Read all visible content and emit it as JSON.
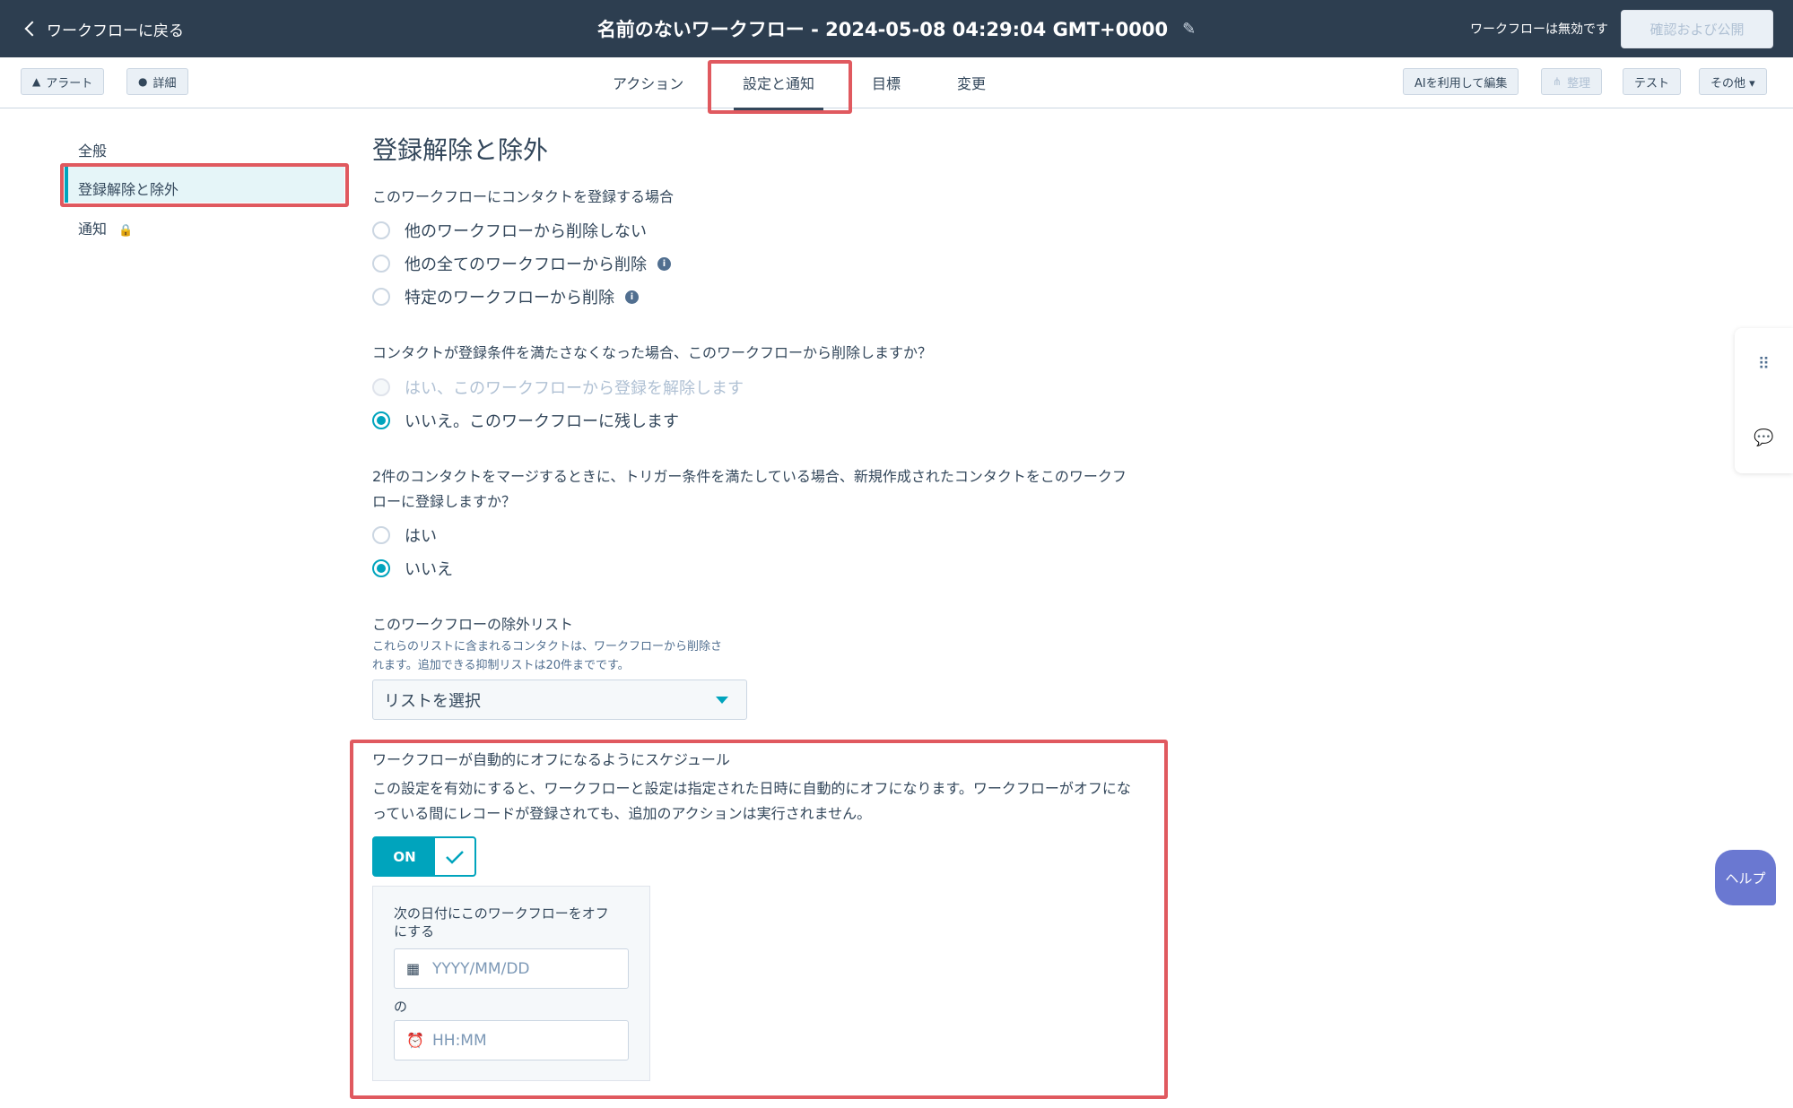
{
  "topbar": {
    "back_label": "ワークフローに戻る",
    "title": "名前のないワークフロー - 2024-05-08 04:29:04 GMT+0000",
    "status": "ワークフローは無効です",
    "publish_label": "確認および公開"
  },
  "subbar": {
    "alert_label": "アラート",
    "details_label": "詳細",
    "tabs": [
      "アクション",
      "設定と通知",
      "目標",
      "変更"
    ],
    "ai_edit_label": "AIを利用して編集",
    "organize_label": "整理",
    "test_label": "テスト",
    "more_label": "その他 ▾"
  },
  "sidebar": {
    "items": [
      "全般",
      "登録解除と除外",
      "通知"
    ]
  },
  "main": {
    "heading": "登録解除と除外",
    "q1": {
      "label": "このワークフローにコンタクトを登録する場合",
      "options": [
        "他のワークフローから削除しない",
        "他の全てのワークフローから削除",
        "特定のワークフローから削除"
      ]
    },
    "q2": {
      "label": "コンタクトが登録条件を満たさなくなった場合、このワークフローから削除しますか？",
      "options": [
        "はい、このワークフローから登録を解除します",
        "いいえ。このワークフローに残します"
      ]
    },
    "q3": {
      "label_line1": "2件のコンタクトをマージするときに、トリガー条件を満たしている場合、新規作成されたコンタクトをこのワークフ",
      "label_line2": "ローに登録しますか？",
      "options": [
        "はい",
        "いいえ"
      ]
    },
    "exclusion": {
      "label": "このワークフローの除外リスト",
      "hint_line1": "これらのリストに含まれるコンタクトは、ワークフローから削除さ",
      "hint_line2": "れます。追加できる抑制リストは20件までです。",
      "select_value": "リストを選択"
    },
    "schedule": {
      "label": "ワークフローが自動的にオフになるようにスケジュール",
      "desc_line1": "この設定を有効にすると、ワークフローと設定は指定された日時に自動的にオフになります。ワークフローがオフにな",
      "desc_line2": "っている間にレコードが登録されても、追加のアクションは実行されません。",
      "toggle_label": "ON",
      "date_label": "次の日付にこのワークフローをオフにする",
      "date_placeholder": "YYYY/MM/DD",
      "no_label": "の",
      "time_placeholder": "HH:MM"
    }
  },
  "help_label": "ヘルプ",
  "colors": {
    "topbar": "#2d3e50",
    "accent": "#00a4bd",
    "highlight": "#e0595f",
    "help": "#6a78d1"
  }
}
